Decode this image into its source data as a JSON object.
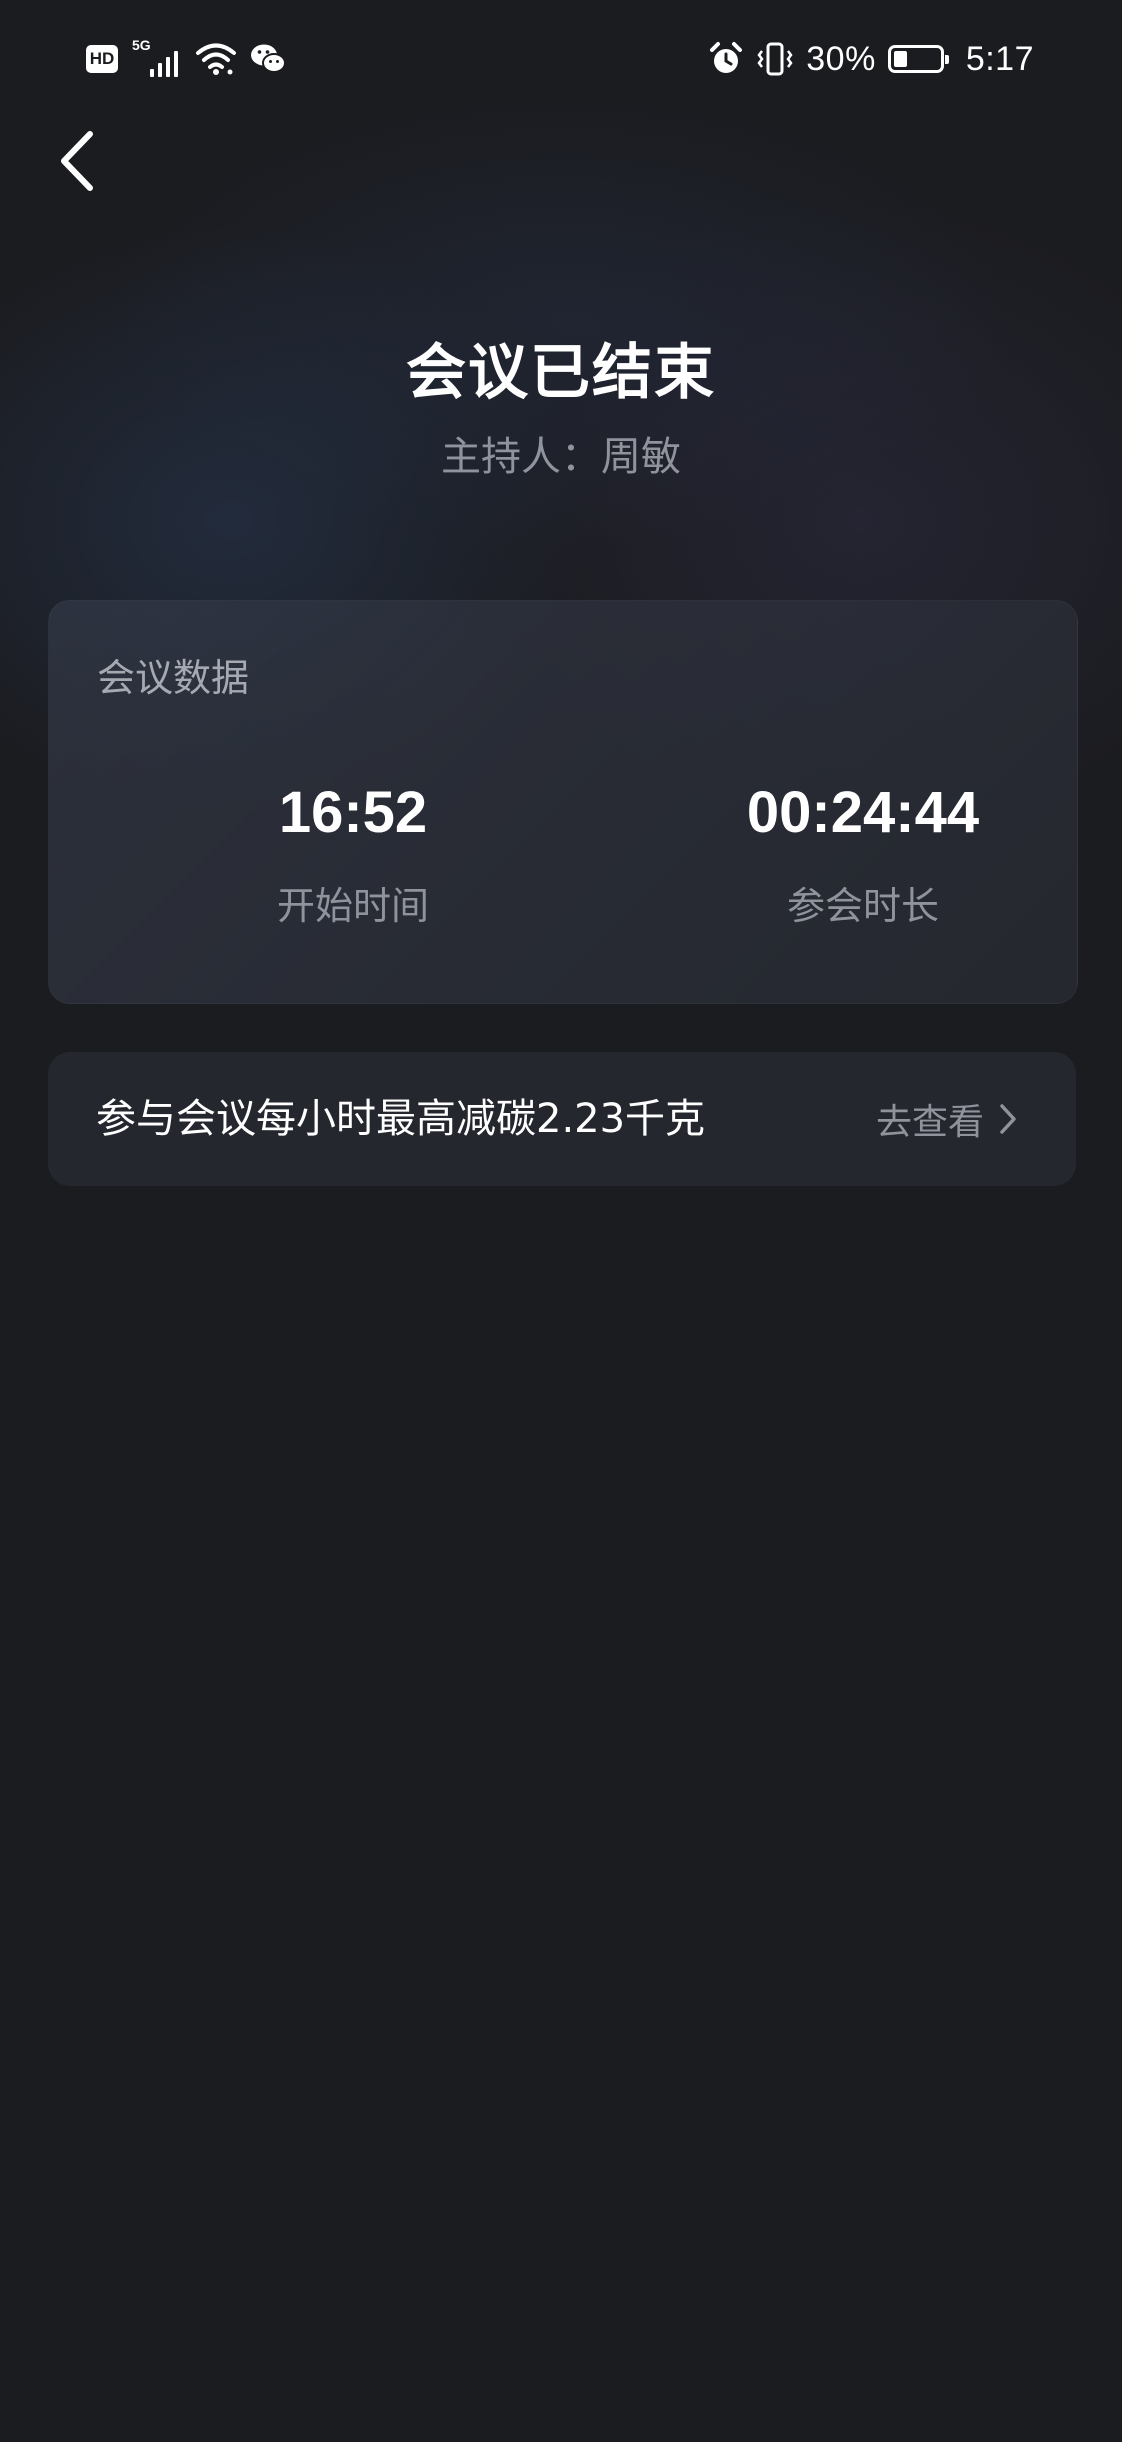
{
  "status_bar": {
    "left_icons": [
      "hd-icon",
      "5g-signal-icon",
      "wifi-icon",
      "wechat-icon"
    ],
    "network_label": "5G",
    "hd_label": "HD",
    "right_icons": [
      "alarm-icon",
      "vibrate-icon",
      "battery-icon"
    ],
    "battery_percent_text": "30%",
    "battery_level": 0.3,
    "time": "5:17"
  },
  "header": {
    "back_icon": "chevron-left-icon",
    "title": "会议已结束",
    "host": "主持人：周敏"
  },
  "stats_card": {
    "label": "会议数据",
    "stats": [
      {
        "value": "16:52",
        "caption": "开始时间"
      },
      {
        "value": "00:24:44",
        "caption": "参会时长"
      }
    ]
  },
  "carbon_row": {
    "text": "参与会议每小时最高减碳2.23千克",
    "link_label": "去查看",
    "link_icon": "chevron-right-icon"
  },
  "colors": {
    "background": "#1b1c20",
    "card": "#25272e",
    "text_primary": "#ffffff",
    "text_secondary": "#8f939c"
  }
}
